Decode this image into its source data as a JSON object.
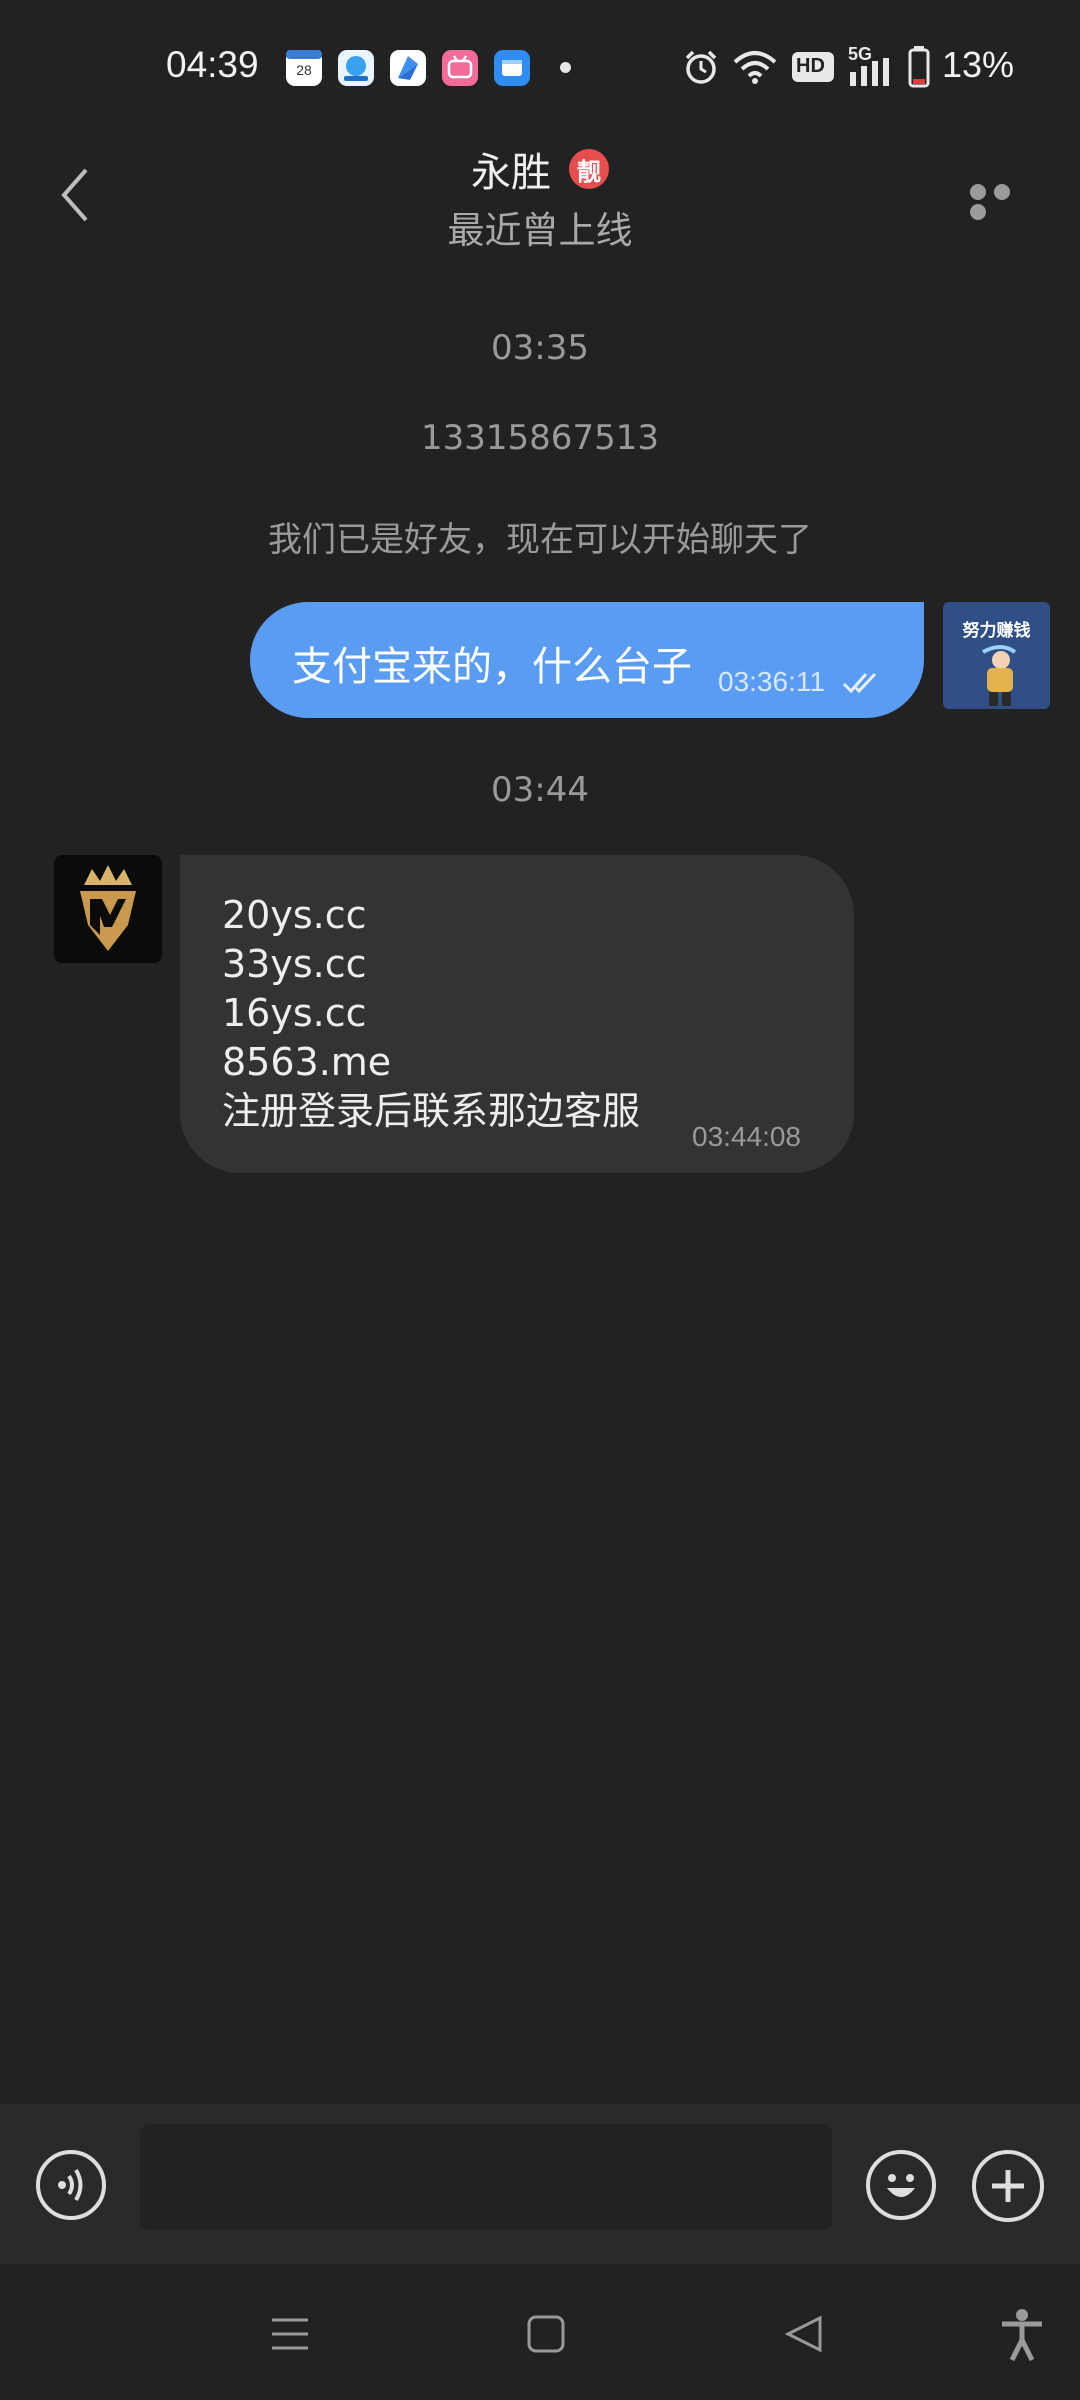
{
  "status_bar": {
    "time": "04:39",
    "calendar_day": "28",
    "battery": "13%",
    "network_label": "5G",
    "hd_label": "HD",
    "icons": [
      "calendar-icon",
      "cloud-drive-icon",
      "browser-icon",
      "bilibili-icon",
      "files-icon",
      "notification-dot-icon",
      "alarm-icon",
      "wifi-icon",
      "hd-voice-icon",
      "signal-icon",
      "battery-icon"
    ]
  },
  "header": {
    "title": "永胜",
    "badge": "靓",
    "subtitle": "最近曾上线",
    "icons": [
      "back-icon",
      "more-icon"
    ]
  },
  "chat": {
    "time_divider_1": "03:35",
    "phone": "13315867513",
    "system_note": "我们已是好友，现在可以开始聊天了",
    "outgoing": {
      "text": "支付宝来的，什么台子",
      "time": "03:36:11",
      "status_icon": "double-check-icon"
    },
    "time_divider_2": "03:44",
    "incoming": {
      "lines": [
        "20ys.cc",
        "33ys.cc",
        "16ys.cc",
        "8563.me",
        "注册登录后联系那边客服"
      ],
      "time": "03:44:08"
    },
    "my_avatar_text": "努力赚钱"
  },
  "input_bar": {
    "placeholder": "",
    "icons": [
      "voice-icon",
      "emoji-icon",
      "plus-icon"
    ]
  },
  "nav_bar": {
    "icons": [
      "menu-icon",
      "home-icon",
      "back-triangle-icon",
      "accessibility-icon"
    ]
  },
  "colors": {
    "background": "#222222",
    "outgoing_bubble": "#5b9cf3",
    "incoming_bubble": "#333333",
    "badge": "#e84d4d"
  }
}
